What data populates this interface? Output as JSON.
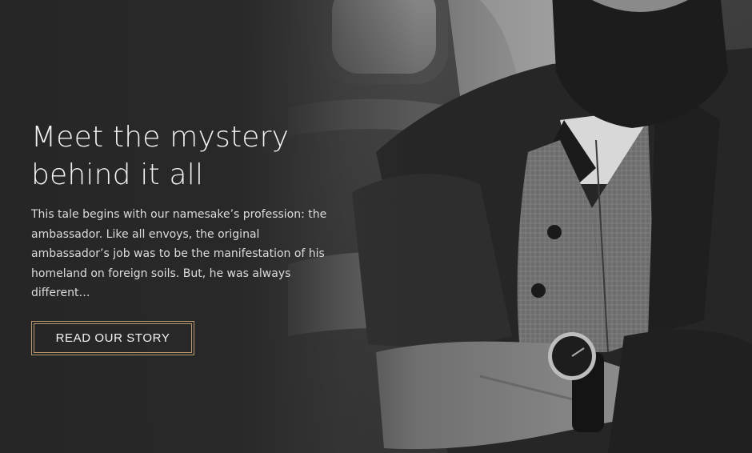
{
  "hero": {
    "title_line1": "Meet the mystery",
    "title_line2": "behind it all",
    "body": "This tale begins with our namesake’s profession: the ambassador. Like all envoys, the original ambassador’s job was to be the manifestation of his homeland on foreign soils. But, he was always different…",
    "cta_label": "READ OUR STORY"
  },
  "colors": {
    "cta_border": "#b89a6e",
    "background": "#2a2a2a",
    "text": "#f2f2f2"
  }
}
